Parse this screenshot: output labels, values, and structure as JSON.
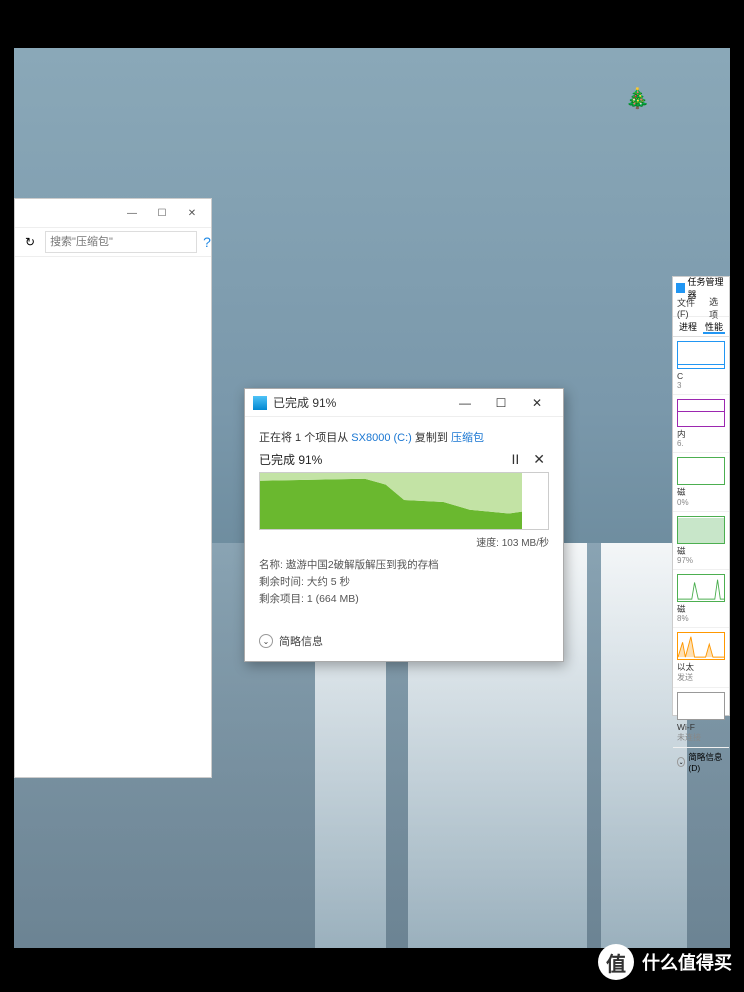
{
  "tree_icon": "🎄",
  "explorer": {
    "refresh": "↻",
    "search_placeholder": "搜索\"压缩包\"",
    "help": "?",
    "minimize": "—",
    "maximize": "☐",
    "close": "✕"
  },
  "copy_dialog": {
    "title": "已完成 91%",
    "minimize": "—",
    "maximize": "☐",
    "close": "✕",
    "line1_prefix": "正在将 1 个项目从 ",
    "source": "SX8000 (C:)",
    "line1_mid": " 复制到 ",
    "dest": "压缩包",
    "percent": "已完成 91%",
    "pause": "II",
    "cancel": "✕",
    "speed": "速度: 103 MB/秒",
    "name_label": "名称: ",
    "name_value": "遨游中国2破解版解压到我的存档",
    "time_label": "剩余时间: ",
    "time_value": "大约 5 秒",
    "items_label": "剩余项目: ",
    "items_value": "1 (664 MB)",
    "footer": "简略信息",
    "chevron": "⌄"
  },
  "taskmgr": {
    "title": "任务管理器",
    "menu_file": "文件(F)",
    "menu_options": "选项",
    "tab_processes": "进程",
    "tab_performance": "性能",
    "cpu_label": "C",
    "cpu_sub": "3",
    "mem_label": "内",
    "mem_sub": "6.",
    "disk0_label": "磁",
    "disk0_sub": "0%",
    "disk1_label": "磁",
    "disk1_sub": "97%",
    "disk2_label": "磁",
    "disk2_sub": "8%",
    "eth_label": "以太",
    "eth_sub": "发送",
    "wifi_label": "Wi-F",
    "wifi_sub": "未连接",
    "footer": "简略信息(D)",
    "footer_chev": "⌄"
  },
  "watermark": {
    "badge": "值",
    "text": "什么值得买"
  }
}
